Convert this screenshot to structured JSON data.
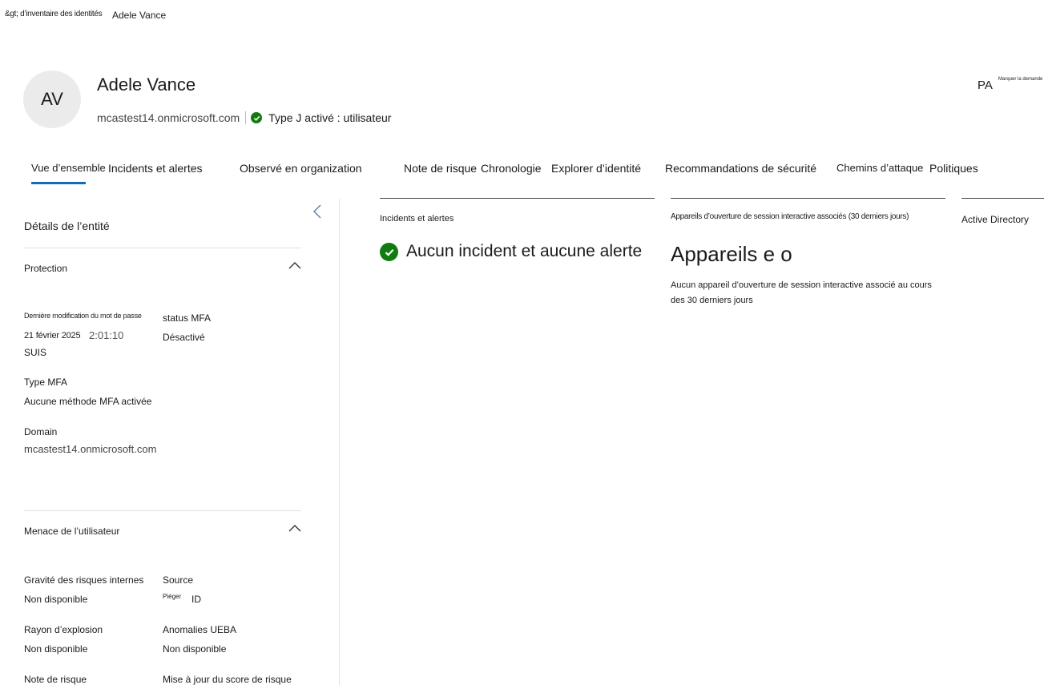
{
  "breadcrumb": {
    "parent": "&gt; d’inventaire des identités",
    "current": "Adele Vance"
  },
  "header": {
    "avatar_initials": "AV",
    "name": "Adele Vance",
    "domain": "mcastest14.onmicrosoft.com",
    "type_status": "Type J activé : utilisateur",
    "right_initials": "PA",
    "mark_request": "Marquer la demande"
  },
  "tabs": [
    "Vue d’ensemble",
    "Incidents et alertes",
    "Observé en organization",
    "Note de risque",
    "Chronologie",
    "Explorer d’identité",
    "Recommandations de sécurité",
    "Chemins d’attaque",
    "Politiques"
  ],
  "entity": {
    "title": "Détails de l’entité",
    "protection": {
      "title": "Protection",
      "last_pwd_label": "Dernière modification du mot de passe",
      "last_pwd_date": "21 février 2025",
      "last_pwd_time": "2:01:10",
      "last_pwd_suffix": "SUIS",
      "mfa_status_label": "status MFA",
      "mfa_status_value": "Désactivé",
      "mfa_type_label": "Type MFA",
      "mfa_type_value": "Aucune méthode MFA activée",
      "domain_label": "Domain",
      "domain_value": "mcastest14.onmicrosoft.com"
    },
    "threat": {
      "title": "Menace de l’utilisateur",
      "insider_label": "Gravité des risques internes",
      "insider_value": "Non disponible",
      "source_label": "Source",
      "source_value_small": "Piéger",
      "source_value": "ID",
      "blast_label": "Rayon d’explosion",
      "blast_value": "Non disponible",
      "ueba_label": "Anomalies UEBA",
      "ueba_value": "Non disponible",
      "risk_label": "Note de risque",
      "risk_update_label": "Mise à jour du score de risque"
    }
  },
  "cards": {
    "incidents": {
      "title": "Incidents et alertes",
      "message": "Aucun incident et aucune alerte"
    },
    "devices": {
      "title": "Appareils d’ouverture de session interactive associés (30 derniers jours)",
      "big": "Appareils e o",
      "line1": "Aucun appareil d’ouverture de session interactive associé au cours",
      "line2": "des 30 derniers jours"
    },
    "ad": {
      "title": "Active Directory"
    }
  }
}
